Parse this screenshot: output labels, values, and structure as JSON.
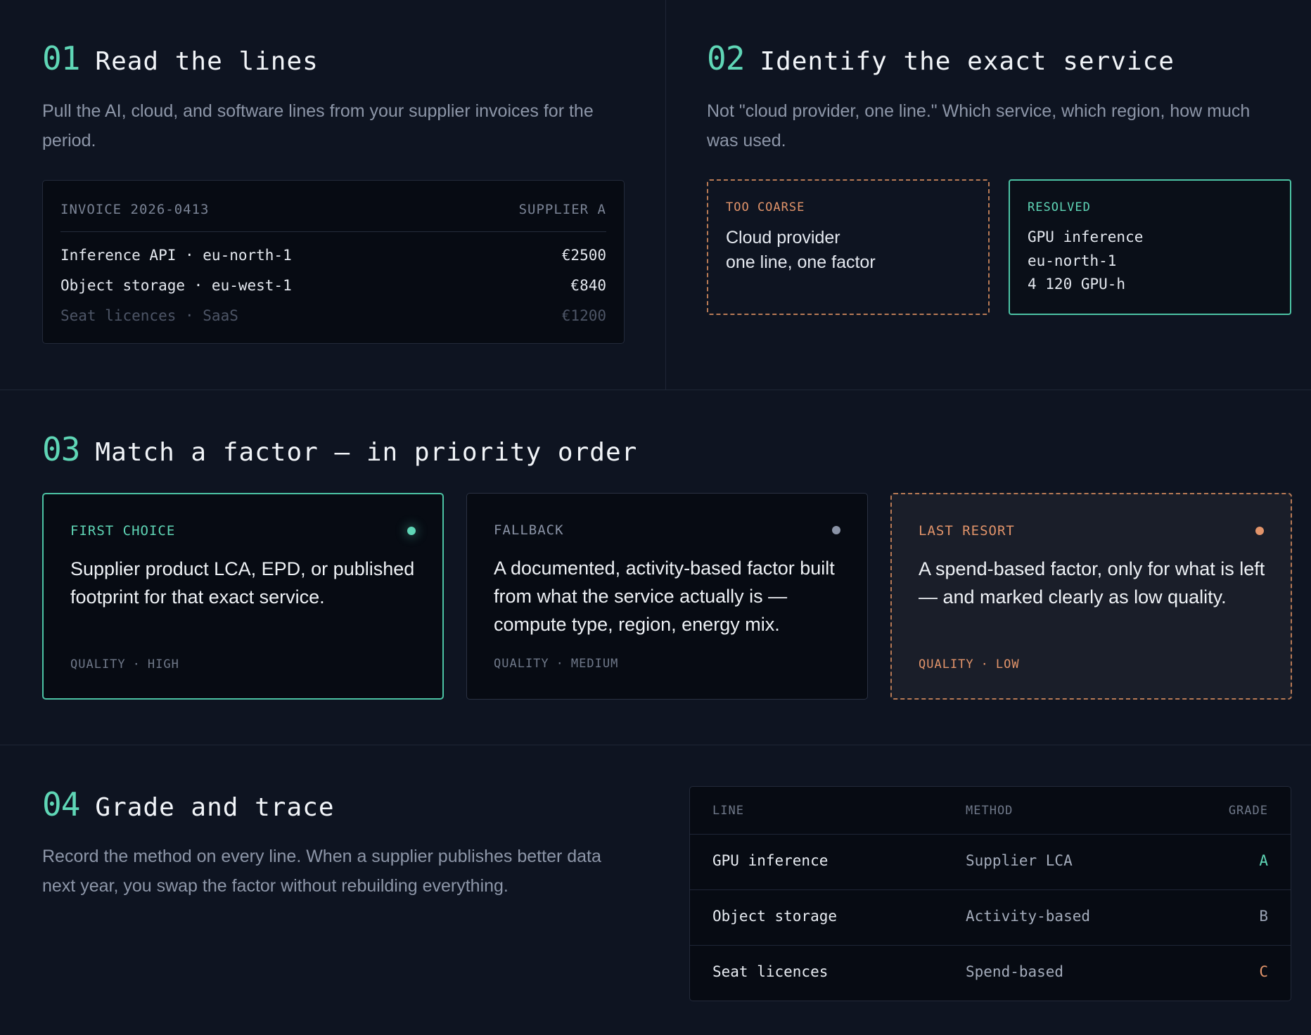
{
  "step1": {
    "number": "01",
    "title": "Read the lines",
    "description": "Pull the AI, cloud, and software lines from your supplier invoices for the period.",
    "invoice": {
      "id": "INVOICE 2026-0413",
      "supplier": "SUPPLIER A",
      "lines": [
        {
          "label": "Inference API · eu-north-1",
          "amount": "€2500"
        },
        {
          "label": "Object storage · eu-west-1",
          "amount": "€840"
        },
        {
          "label": "Seat licences · SaaS",
          "amount": "€1200"
        }
      ]
    }
  },
  "step2": {
    "number": "02",
    "title": "Identify the exact service",
    "description": "Not \"cloud provider, one line.\" Which service, which region, how much was used.",
    "coarse": {
      "tag": "TOO COARSE",
      "lines": [
        "Cloud provider",
        "one line, one factor"
      ]
    },
    "resolved": {
      "tag": "RESOLVED",
      "lines": [
        "GPU inference",
        "eu-north-1",
        "4 120 GPU-h"
      ]
    }
  },
  "step3": {
    "number": "03",
    "title": "Match a factor — in priority order",
    "cards": [
      {
        "tag": "FIRST CHOICE",
        "body": "Supplier product LCA, EPD, or published footprint for that exact service.",
        "quality_label": "QUALITY",
        "quality_sep": "·",
        "quality_value": "HIGH",
        "color": "#5fd6b6"
      },
      {
        "tag": "FALLBACK",
        "body": "A documented, activity-based factor built from what the service actually is — compute type, region, energy mix.",
        "quality_label": "QUALITY",
        "quality_sep": "·",
        "quality_value": "MEDIUM",
        "color": "#8a93a6"
      },
      {
        "tag": "LAST RESORT",
        "body": "A spend-based factor, only for what is left — and marked clearly as low quality.",
        "quality_label": "QUALITY",
        "quality_sep": "·",
        "quality_value": "LOW",
        "color": "#e2946a"
      }
    ]
  },
  "step4": {
    "number": "04",
    "title": "Grade and trace",
    "description": "Record the method on every line. When a supplier publishes better data next year, you swap the factor without rebuilding everything.",
    "table": {
      "headers": {
        "line": "LINE",
        "method": "METHOD",
        "grade": "GRADE"
      },
      "rows": [
        {
          "line": "GPU inference",
          "method": "Supplier LCA",
          "grade": "A",
          "grade_color": "#5fd6b6"
        },
        {
          "line": "Object storage",
          "method": "Activity-based",
          "grade": "B",
          "grade_color": "#9aa3b5"
        },
        {
          "line": "Seat licences",
          "method": "Spend-based",
          "grade": "C",
          "grade_color": "#e2946a"
        }
      ]
    }
  }
}
